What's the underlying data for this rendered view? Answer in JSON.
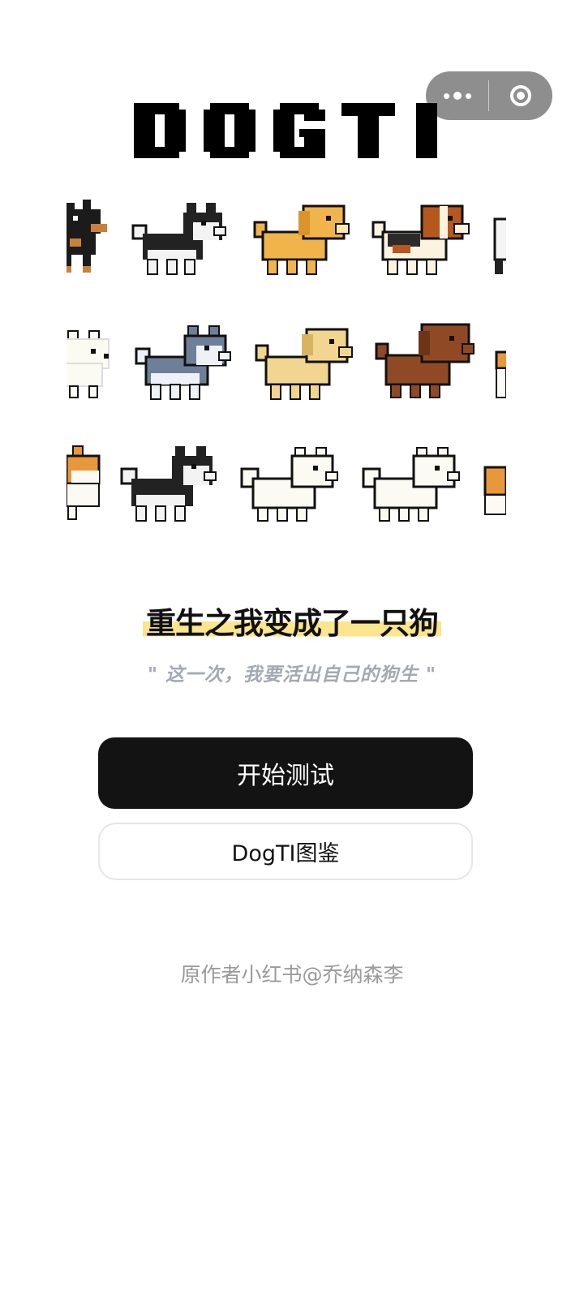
{
  "app": {
    "logo_text": "DOGTI"
  },
  "capsule": {
    "more_icon": "more-dots-icon",
    "close_icon": "target-close-icon"
  },
  "dogs": [
    [
      "doberman",
      "husky-black",
      "golden",
      "beagle",
      "white-partial"
    ],
    [
      "white-spitz",
      "husky-grey",
      "labrador-cream",
      "poodle-brown",
      "shiba-partial"
    ],
    [
      "shiba-partial",
      "husky-black",
      "samoyed",
      "samoyed",
      "shiba-partial"
    ]
  ],
  "headline": {
    "title": "重生之我变成了一只狗",
    "quote": "\" 这一次，我要活出自己的狗生 \""
  },
  "buttons": {
    "start_label": "开始测试",
    "gallery_label": "DogTI图鉴"
  },
  "footer": {
    "credit": "原作者小红书@乔纳森李"
  },
  "colors": {
    "primary_button": "#131313",
    "highlight": "#fbe58d",
    "quote": "#a3a8b3",
    "credit": "#9a9a9a"
  }
}
